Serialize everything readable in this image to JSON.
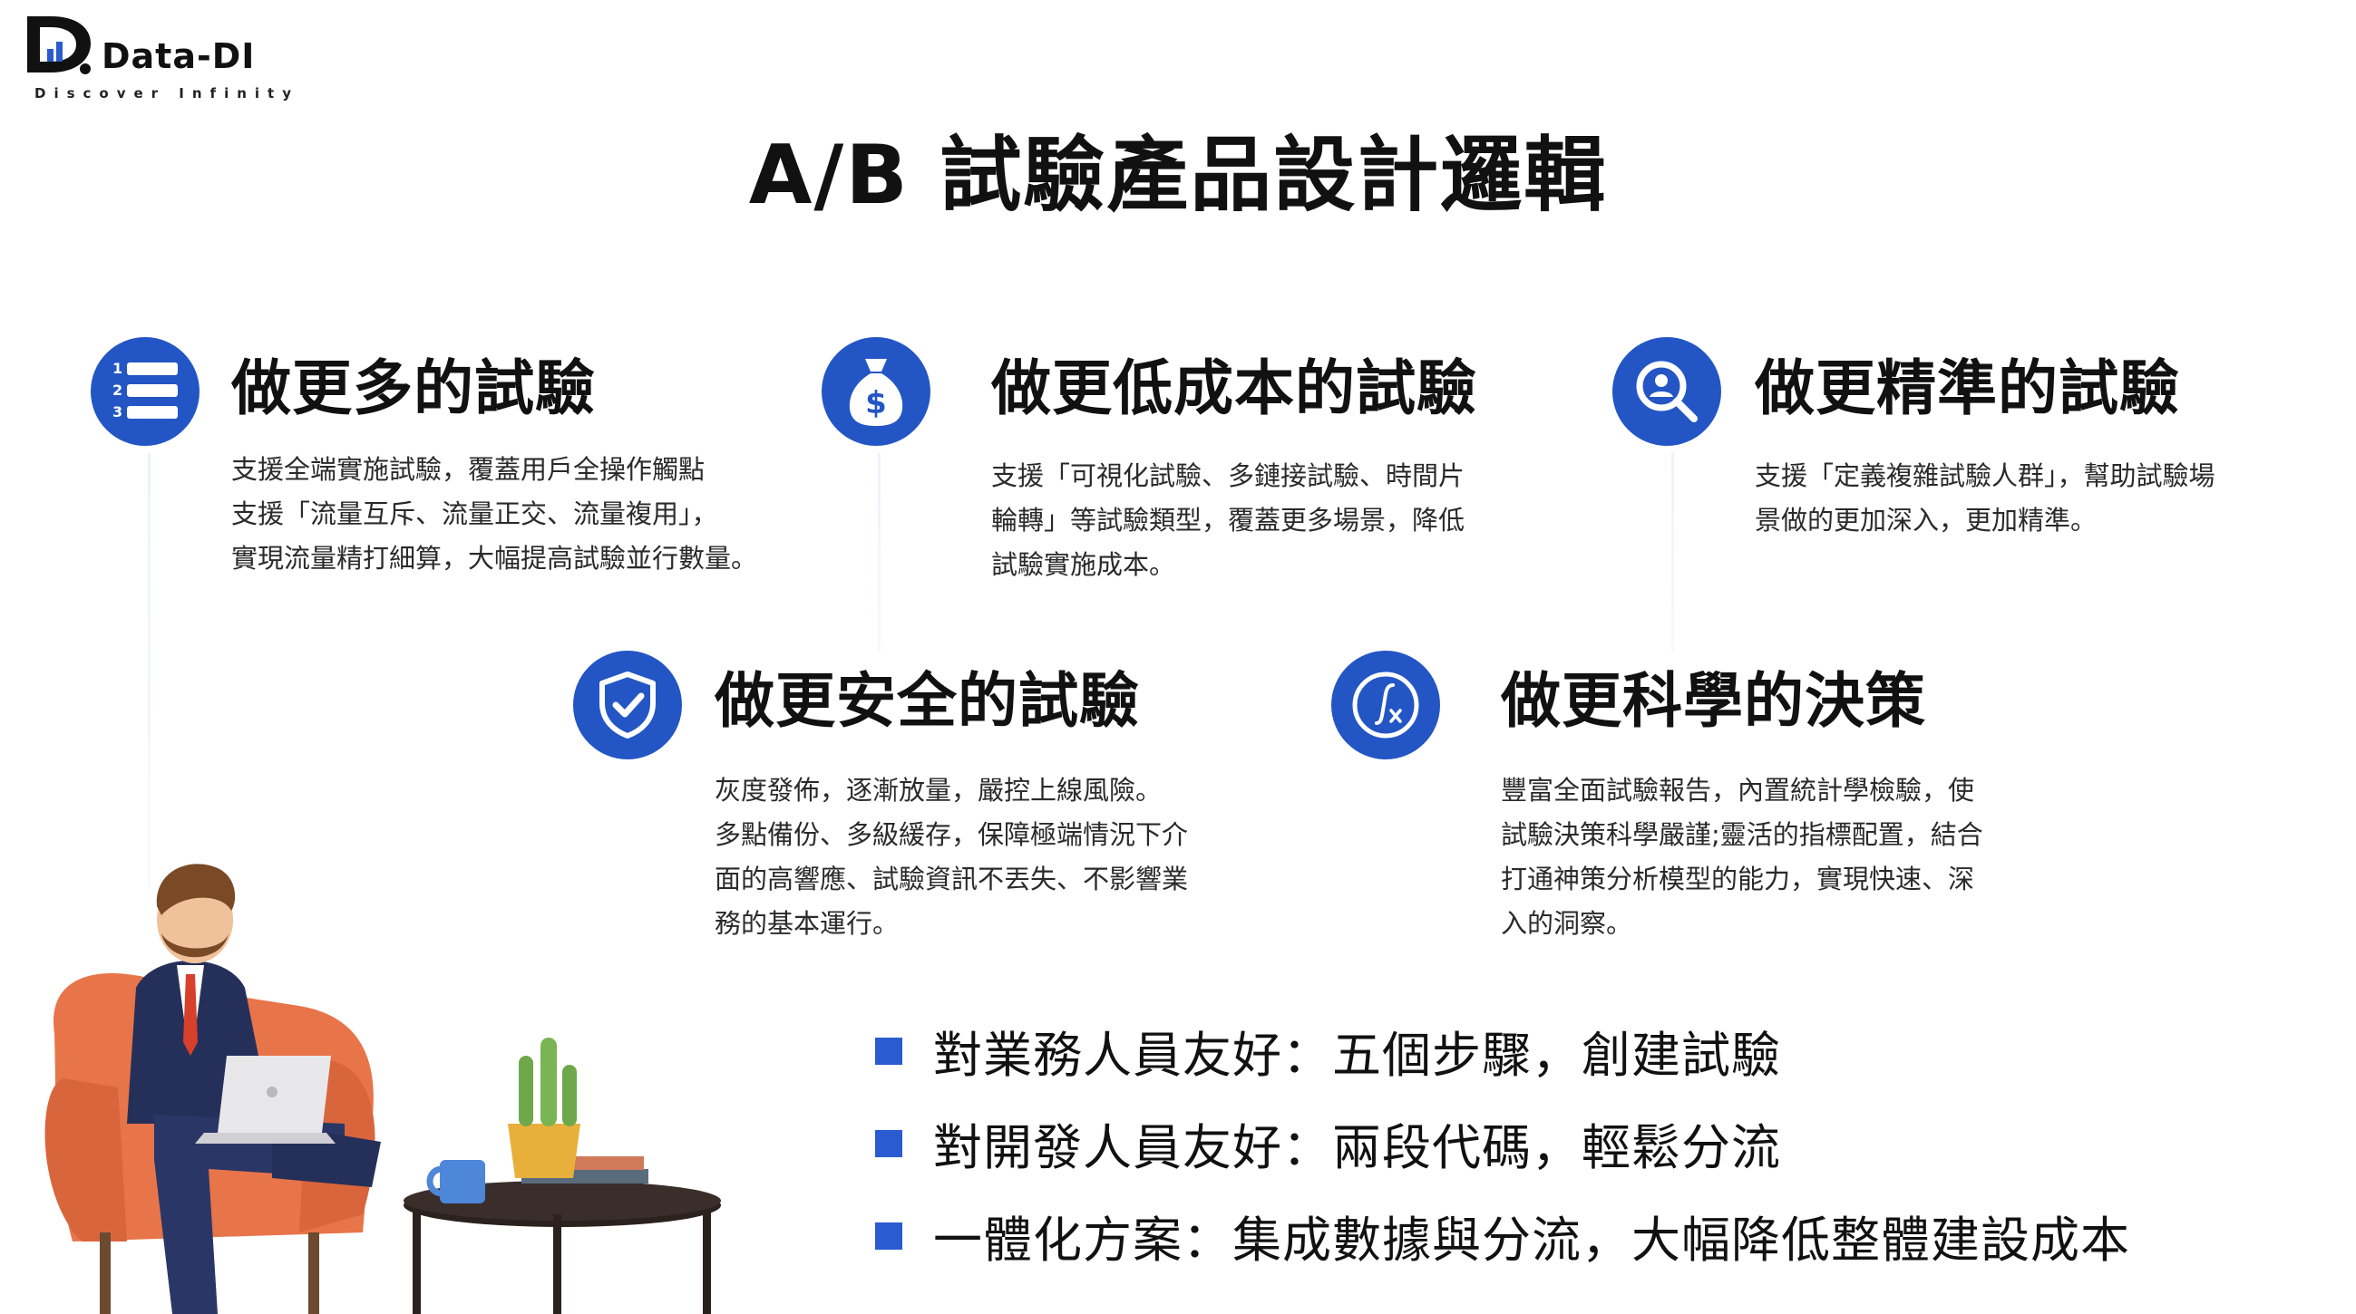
{
  "logo": {
    "brand": "Data-DI",
    "tagline": "Discover Infinity"
  },
  "title": "A/B 試驗產品設計邏輯",
  "features": [
    {
      "icon": "numbered-list-icon",
      "title": "做更多的試驗",
      "lines": [
        "支援全端實施試驗，覆蓋用戶全操作觸點",
        "支援「流量互斥、流量正交、流量複用」，",
        "實現流量精打細算，大幅提高試驗並行數量。"
      ]
    },
    {
      "icon": "money-bag-icon",
      "title": "做更低成本的試驗",
      "lines": [
        "支援「可視化試驗、多鏈接試驗、時間片",
        "輪轉」等試驗類型，覆蓋更多場景，降低",
        "試驗實施成本。"
      ]
    },
    {
      "icon": "user-search-icon",
      "title": "做更精準的試驗",
      "lines": [
        "支援「定義複雜試驗人群」，幫助試驗場",
        "景做的更加深入，更加精準。"
      ]
    },
    {
      "icon": "shield-check-icon",
      "title": "做更安全的試驗",
      "lines": [
        "灰度發佈，逐漸放量，嚴控上線風險。",
        "多點備份、多級緩存，保障極端情況下介",
        "面的高響應、試驗資訊不丟失、不影響業",
        "務的基本運行。"
      ]
    },
    {
      "icon": "function-icon",
      "title": "做更科學的決策",
      "lines": [
        "豐富全面試驗報告，內置統計學檢驗，使",
        "試驗決策科學嚴謹;靈活的指標配置，結合",
        "打通神策分析模型的能力，實現快速、深",
        "入的洞察。"
      ]
    }
  ],
  "bullets": [
    "對業務人員友好：五個步驟，創建試驗",
    "對開發人員友好：兩段代碼，輕鬆分流",
    "一體化方案：集成數據與分流，大幅降低整體建設成本"
  ],
  "colors": {
    "accent": "#2356c4",
    "bullet": "#2a5bd0",
    "chair": "#e8744a"
  }
}
